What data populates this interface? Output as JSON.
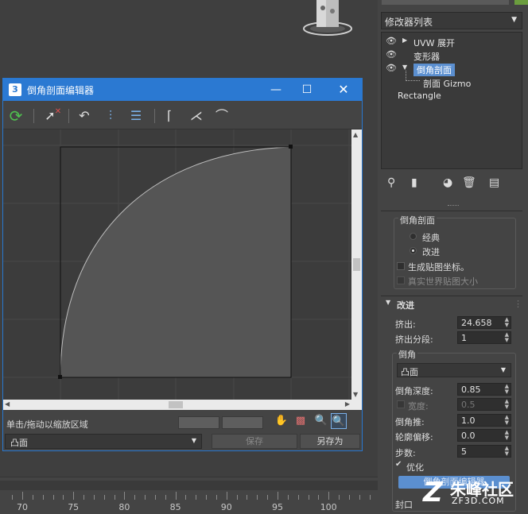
{
  "viewport": {
    "ruler_labels": [
      "70",
      "75",
      "80",
      "85",
      "90",
      "95",
      "100"
    ]
  },
  "modifier_panel": {
    "modifier_list_label": "修改器列表",
    "stack": [
      {
        "label": "UVW 展开",
        "expandable": true,
        "expanded": false,
        "selected": false
      },
      {
        "label": "变形器",
        "expandable": false,
        "expanded": false,
        "selected": false
      },
      {
        "label": "倒角剖面",
        "expandable": true,
        "expanded": true,
        "selected": true
      },
      {
        "label": "剖面 Gizmo",
        "expandable": false,
        "expanded": false,
        "selected": false,
        "sub": true
      },
      {
        "label": "Rectangle",
        "expandable": false,
        "expanded": false,
        "selected": false,
        "base": true
      }
    ],
    "bevel_group": {
      "title": "倒角剖面",
      "radio_classic": "经典",
      "radio_improved": "改进",
      "selected_radio": "改进",
      "gen_map_coords": "生成贴图坐标。",
      "real_world_map": "真实世界贴图大小"
    },
    "improved_rollout": {
      "title": "改进",
      "extrude_label": "挤出:",
      "extrude_value": "24.658",
      "extrude_segs_label": "挤出分段:",
      "extrude_segs_value": "1",
      "bevel_group_label": "倒角",
      "bevel_type": "凸面",
      "bevel_depth_label": "倒角深度:",
      "bevel_depth_value": "0.85",
      "width_label": "宽度:",
      "width_value": "0.5",
      "bevel_push_label": "倒角推:",
      "bevel_push_value": "1.0",
      "contour_offset_label": "轮廓偏移:",
      "contour_offset_value": "0.0",
      "steps_label": "步数:",
      "steps_value": "5",
      "optimize_label": "优化",
      "editor_button": "倒角剖面编辑器",
      "cap_label": "封口"
    }
  },
  "watermark": {
    "brand": "朱峰社区",
    "domain": "ZF3D.COM"
  },
  "editor": {
    "title": "倒角剖面编辑器",
    "app_icon_text": "3",
    "status_text": "单击/拖动以缩放区域",
    "profile_dropdown": "凸面",
    "save_label": "保存",
    "save_as_label": "另存为",
    "curve_color": "#555555",
    "accent": "#2b79d2"
  },
  "colors": {
    "titlebar": "#2b79d2",
    "selection": "#5b8fd0",
    "panel_bg": "#444444"
  }
}
